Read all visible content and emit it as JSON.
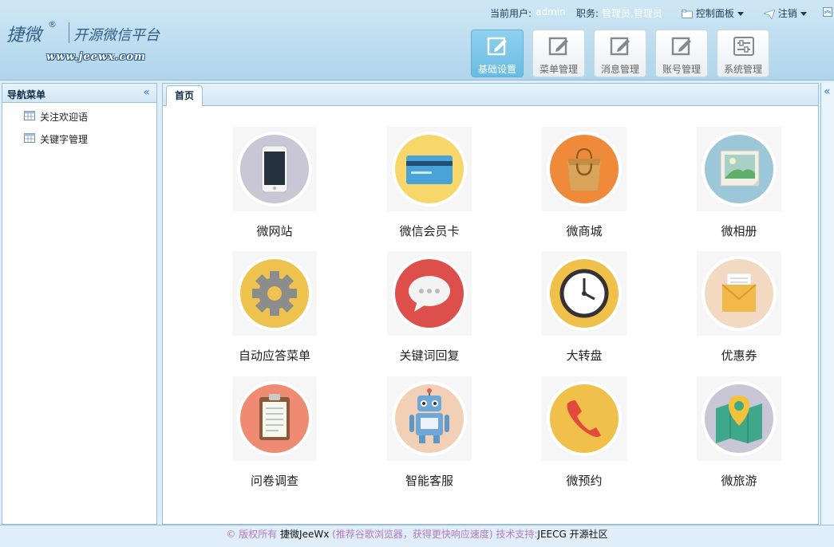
{
  "header": {
    "logo_main": "捷微",
    "logo_reg": "®",
    "logo_sub": "开源微信平台",
    "logo_url": "www.jeewx.com"
  },
  "userbar": {
    "current_user_label": "当前用户:",
    "current_user_value": "admin",
    "role_label": "职务:",
    "role_value": "管理员,管理员",
    "control_panel": "控制面板",
    "logout": "注销"
  },
  "topnav": [
    {
      "label": "基础设置",
      "active": true
    },
    {
      "label": "菜单管理",
      "active": false
    },
    {
      "label": "消息管理",
      "active": false
    },
    {
      "label": "账号管理",
      "active": false
    },
    {
      "label": "系统管理",
      "active": false
    }
  ],
  "sidebar": {
    "title": "导航菜单",
    "items": [
      {
        "label": "关注欢迎语"
      },
      {
        "label": "关键字管理"
      }
    ]
  },
  "tabs": [
    {
      "label": "首页"
    }
  ],
  "apps": [
    {
      "label": "微网站",
      "icon": "phone-icon",
      "color": "#c9c6d6"
    },
    {
      "label": "微信会员卡",
      "icon": "member-card-icon",
      "color": "#f7d66a"
    },
    {
      "label": "微商城",
      "icon": "shopping-bag-icon",
      "color": "#ee8a3a"
    },
    {
      "label": "微相册",
      "icon": "photo-album-icon",
      "color": "#9bc7d8"
    },
    {
      "label": "自动应答菜单",
      "icon": "gear-icon",
      "color": "#edc24f"
    },
    {
      "label": "关键词回复",
      "icon": "chat-bubble-icon",
      "color": "#dd4f4a"
    },
    {
      "label": "大转盘",
      "icon": "clock-icon",
      "color": "#f0c04a"
    },
    {
      "label": "优惠券",
      "icon": "coupon-envelope-icon",
      "color": "#f3d9c2"
    },
    {
      "label": "问卷调查",
      "icon": "clipboard-icon",
      "color": "#f08b73"
    },
    {
      "label": "智能客服",
      "icon": "robot-icon",
      "color": "#f1d0b5"
    },
    {
      "label": "微预约",
      "icon": "telephone-icon",
      "color": "#f0c04a"
    },
    {
      "label": "微旅游",
      "icon": "map-pin-icon",
      "color": "#c9c6d6"
    }
  ],
  "footer": {
    "part1": "© 版权所有",
    "part2": "捷微JeeWx",
    "part3": "(推荐谷歌浏览器，获得更快响应速度)",
    "part4": "技术支持:",
    "part5": "JEECG 开源社区"
  },
  "colors": {
    "header_bg": "#bcdcef",
    "border": "#97bfdc",
    "active_nav": "#69bbe2"
  }
}
